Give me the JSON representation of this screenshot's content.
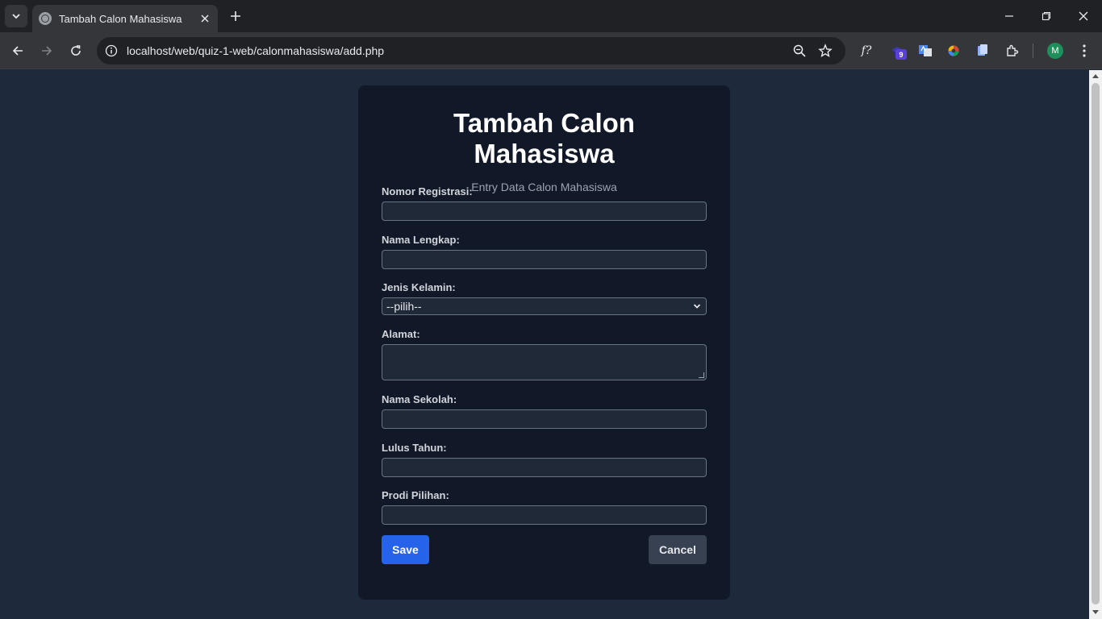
{
  "browser": {
    "tab_title": "Tambah Calon Mahasiswa",
    "url": "localhost/web/quiz-1-web/calonmahasiswa/add.php",
    "extension_badge": "9",
    "profile_initial": "M",
    "ext_fx_label": "f?"
  },
  "form": {
    "title": "Tambah Calon Mahasiswa",
    "subtitle": "Entry Data Calon Mahasiswa",
    "fields": {
      "nomor_registrasi": {
        "label": "Nomor Registrasi:",
        "value": ""
      },
      "nama_lengkap": {
        "label": "Nama Lengkap:",
        "value": ""
      },
      "jenis_kelamin": {
        "label": "Jenis Kelamin:",
        "selected": "--pilih--"
      },
      "alamat": {
        "label": "Alamat:",
        "value": ""
      },
      "nama_sekolah": {
        "label": "Nama Sekolah:",
        "value": ""
      },
      "lulus_tahun": {
        "label": "Lulus Tahun:",
        "value": ""
      },
      "prodi_pilihan": {
        "label": "Prodi Pilihan:",
        "value": ""
      }
    },
    "save_label": "Save",
    "cancel_label": "Cancel"
  },
  "colors": {
    "page_bg": "#1e293b",
    "card_bg": "#111827",
    "input_bg": "#1f2937",
    "save_bg": "#2563eb",
    "cancel_bg": "#374151"
  }
}
